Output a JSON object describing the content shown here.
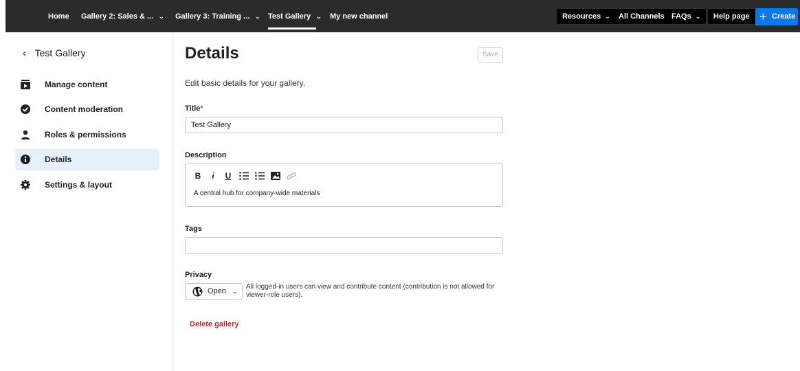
{
  "nav": {
    "home": "Home",
    "gallery2": "Gallery 2: Sales & ...",
    "gallery3": "Gallery 3: Training ...",
    "test_gallery": "Test Gallery",
    "my_channel": "My new channel",
    "chevron": "⌄"
  },
  "right_nav": {
    "resources": "Resources",
    "all_channels": "All Channels",
    "faqs": "FAQs",
    "help": "Help page",
    "create": "Create",
    "create_icon": "+"
  },
  "sidebar": {
    "back_label": "Test Gallery",
    "back_arrow": "‹",
    "items": [
      {
        "label": "Manage content",
        "icon": "play-box-icon"
      },
      {
        "label": "Content moderation",
        "icon": "check-circle-icon"
      },
      {
        "label": "Roles & permissions",
        "icon": "person-icon"
      },
      {
        "label": "Details",
        "icon": "info-circle-icon",
        "active": true
      },
      {
        "label": "Settings & layout",
        "icon": "gear-icon"
      }
    ]
  },
  "main": {
    "title": "Details",
    "save_label": "Save",
    "subtitle": "Edit basic details for your gallery.",
    "title_field": {
      "label": "Title",
      "required_mark": "*",
      "value": "Test Gallery"
    },
    "description": {
      "label": "Description",
      "value": "A central hub for company-wide materials",
      "toolbar": {
        "bold": "B",
        "italic": "i",
        "underline": "U"
      }
    },
    "tags": {
      "label": "Tags",
      "value": ""
    },
    "privacy": {
      "label": "Privacy",
      "selected": "Open",
      "description": "All logged-in users can view and contribute content (contribution is not allowed for viewer-role users)."
    },
    "delete_label": "Delete gallery"
  },
  "colors": {
    "topbar": "#2b2b2b",
    "accent": "#0a78ea",
    "active_bg": "#e6f0fb",
    "danger": "#c7252f"
  }
}
